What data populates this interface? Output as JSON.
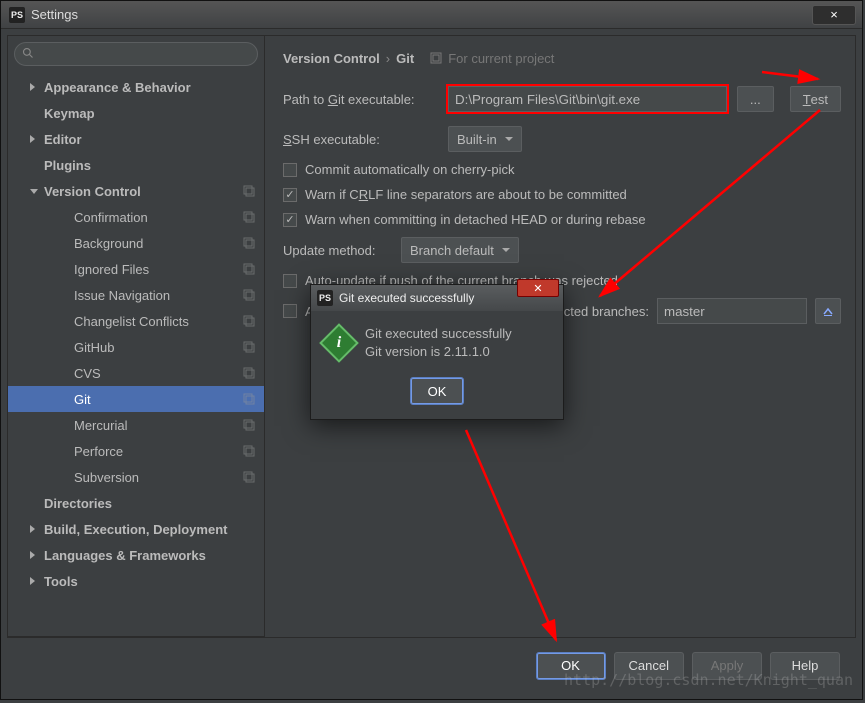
{
  "window_title": "Settings",
  "close_glyph": "×",
  "search": {
    "placeholder": ""
  },
  "sidebar": [
    {
      "label": "Appearance & Behavior",
      "lvl": 1,
      "bold": true,
      "tri": "collapsed"
    },
    {
      "label": "Keymap",
      "lvl": 1,
      "bold": true
    },
    {
      "label": "Editor",
      "lvl": 1,
      "bold": true,
      "tri": "collapsed"
    },
    {
      "label": "Plugins",
      "lvl": 1,
      "bold": true
    },
    {
      "label": "Version Control",
      "lvl": 1,
      "bold": true,
      "tri": "expanded",
      "badge": true
    },
    {
      "label": "Confirmation",
      "lvl": 2,
      "badge": true
    },
    {
      "label": "Background",
      "lvl": 2,
      "badge": true
    },
    {
      "label": "Ignored Files",
      "lvl": 2,
      "badge": true
    },
    {
      "label": "Issue Navigation",
      "lvl": 2,
      "badge": true
    },
    {
      "label": "Changelist Conflicts",
      "lvl": 2,
      "badge": true
    },
    {
      "label": "GitHub",
      "lvl": 2,
      "badge": true
    },
    {
      "label": "CVS",
      "lvl": 2,
      "badge": true
    },
    {
      "label": "Git",
      "lvl": 2,
      "selected": true,
      "badge": true
    },
    {
      "label": "Mercurial",
      "lvl": 2,
      "badge": true
    },
    {
      "label": "Perforce",
      "lvl": 2,
      "badge": true
    },
    {
      "label": "Subversion",
      "lvl": 2,
      "badge": true
    },
    {
      "label": "Directories",
      "lvl": 1,
      "bold": true
    },
    {
      "label": "Build, Execution, Deployment",
      "lvl": 1,
      "bold": true,
      "tri": "collapsed"
    },
    {
      "label": "Languages & Frameworks",
      "lvl": 1,
      "bold": true,
      "tri": "collapsed"
    },
    {
      "label": "Tools",
      "lvl": 1,
      "bold": true,
      "tri": "collapsed"
    }
  ],
  "breadcrumb": {
    "a": "Version Control",
    "b": "Git",
    "hint": "For current project"
  },
  "form": {
    "path_label_prefix": "Path to ",
    "path_label_u": "G",
    "path_label_suffix": "it executable:",
    "path_value": "D:\\Program Files\\Git\\bin\\git.exe",
    "browse_label": "...",
    "test_u": "T",
    "test_suffix": "est",
    "ssh_u": "S",
    "ssh_suffix": "SH executable:",
    "ssh_value": "Built-in",
    "c1": "Commit automatically on cherry-pick",
    "c2_a": "Warn if C",
    "c2_u": "R",
    "c2_b": "LF line separators are about to be committed",
    "c3": "Warn when committing in detached HEAD or during rebase",
    "update_label": "Update method:",
    "update_value": "Branch default",
    "c4": "Auto-update if push of the current branch was rejected",
    "c5_a": "A",
    "c5_b": "tected branches:",
    "protected_value": "master"
  },
  "buttons": {
    "ok": "OK",
    "cancel": "Cancel",
    "apply": "Apply",
    "help": "Help"
  },
  "dialog": {
    "title": "Git executed successfully",
    "line1": "Git executed successfully",
    "line2": "Git version is 2.11.1.0",
    "ok": "OK"
  },
  "watermark": "http://blog.csdn.net/Knight_quan"
}
